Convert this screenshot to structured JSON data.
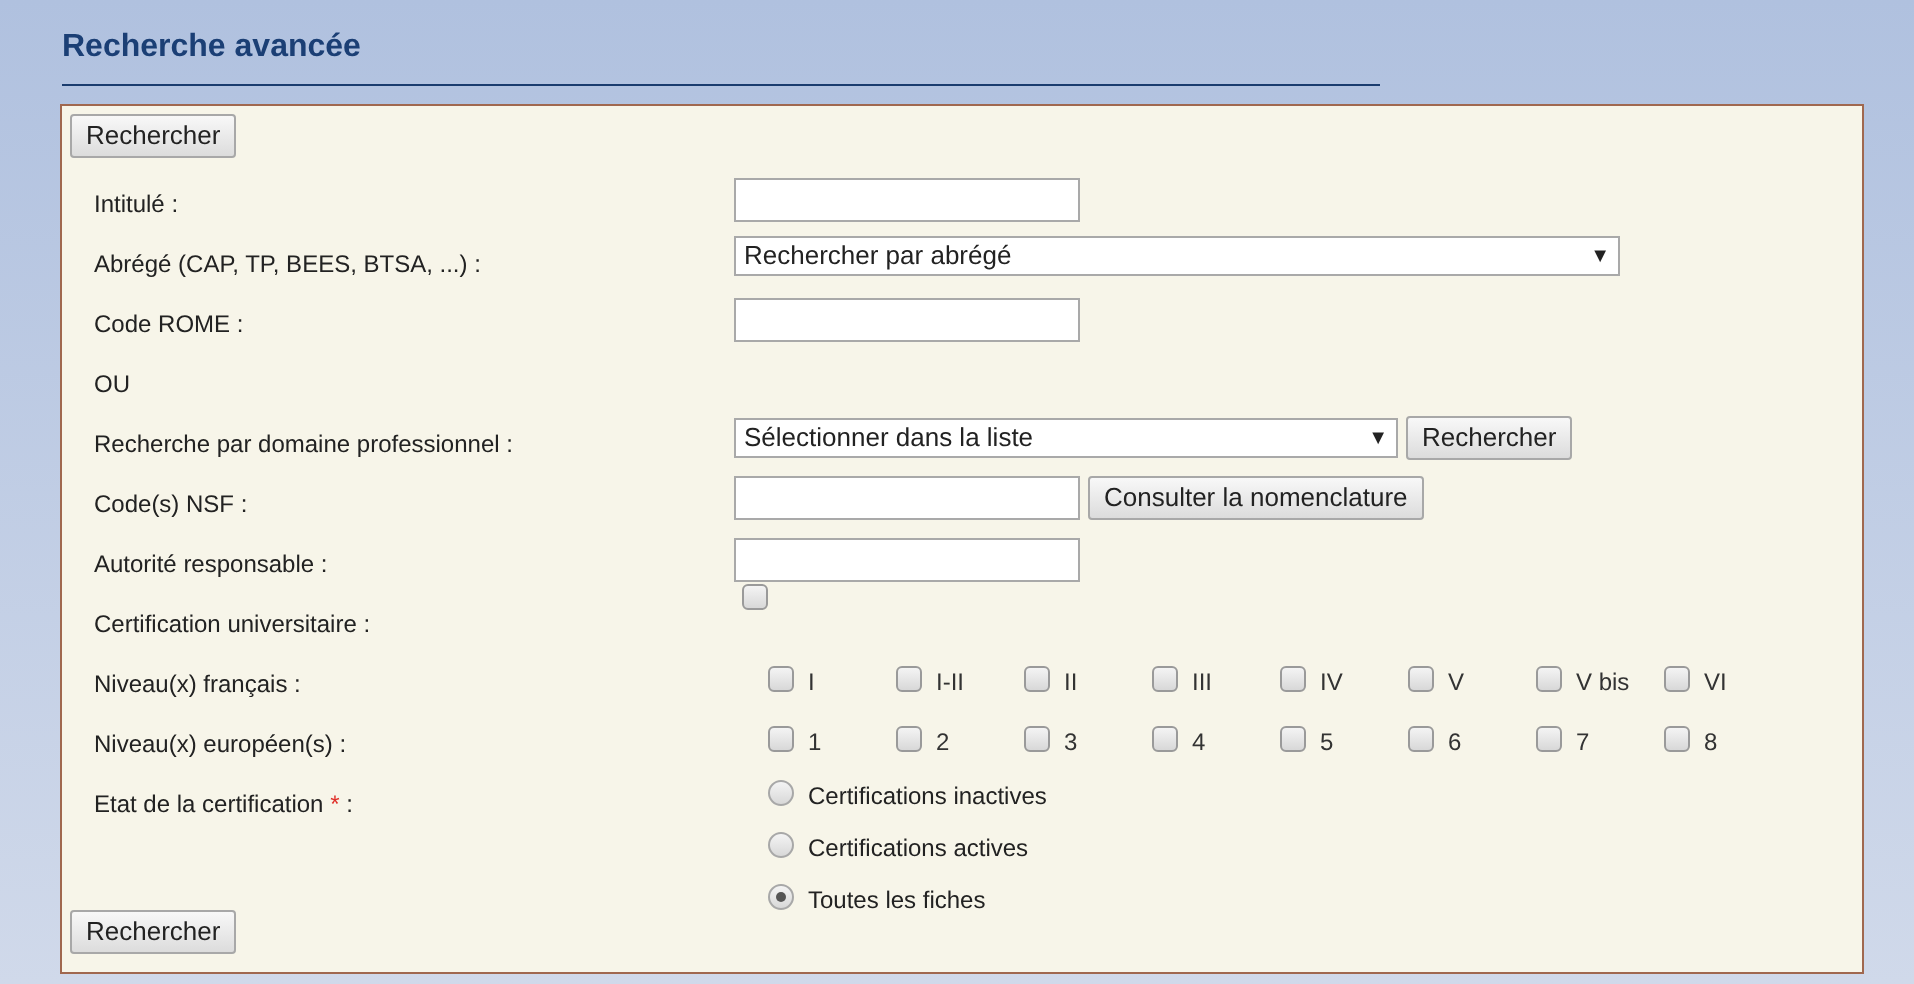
{
  "title": "Recherche avancée",
  "top_button": "Rechercher",
  "rows": [
    {
      "kind": "text",
      "label": "Intitulé :"
    },
    {
      "kind": "select",
      "label": "Abrégé (CAP, TP, BEES, BTSA, ...) :",
      "value": "Rechercher par abrégé",
      "arrow": "▼"
    },
    {
      "kind": "text",
      "label": "Code ROME :"
    },
    {
      "kind": "separator",
      "label": "OU"
    },
    {
      "kind": "select_button",
      "label": "Recherche par domaine professionnel :",
      "value": "Sélectionner dans la liste",
      "arrow": "▼",
      "button": "Rechercher"
    },
    {
      "kind": "text_button",
      "label": "Code(s) NSF :",
      "button": "Consulter la nomenclature"
    },
    {
      "kind": "text",
      "label": "Autorité responsable :"
    },
    {
      "kind": "checkbox",
      "label": "Certification universitaire :",
      "checked": false
    },
    {
      "kind": "checkboxes",
      "label": "Niveau(x) français :",
      "options": [
        {
          "label": "I",
          "checked": false
        },
        {
          "label": "I-II",
          "checked": false
        },
        {
          "label": "II",
          "checked": false
        },
        {
          "label": "III",
          "checked": false
        },
        {
          "label": "IV",
          "checked": false
        },
        {
          "label": "V",
          "checked": false
        },
        {
          "label": "V bis",
          "checked": false
        },
        {
          "label": "VI",
          "checked": false
        }
      ]
    },
    {
      "kind": "checkboxes",
      "label": "Niveau(x) européen(s) :",
      "options": [
        {
          "label": "1",
          "checked": false
        },
        {
          "label": "2",
          "checked": false
        },
        {
          "label": "3",
          "checked": false
        },
        {
          "label": "4",
          "checked": false
        },
        {
          "label": "5",
          "checked": false
        },
        {
          "label": "6",
          "checked": false
        },
        {
          "label": "7",
          "checked": false
        },
        {
          "label": "8",
          "checked": false
        }
      ]
    },
    {
      "kind": "radios",
      "label": "Etat de la certification",
      "required_mark": "*",
      "label_end": ":",
      "options": [
        {
          "label": "Certifications inactives",
          "selected": false
        },
        {
          "label": "Certifications actives",
          "selected": false
        },
        {
          "label": "Toutes les fiches",
          "selected": true
        }
      ]
    }
  ],
  "bottom_button": "Rechercher"
}
